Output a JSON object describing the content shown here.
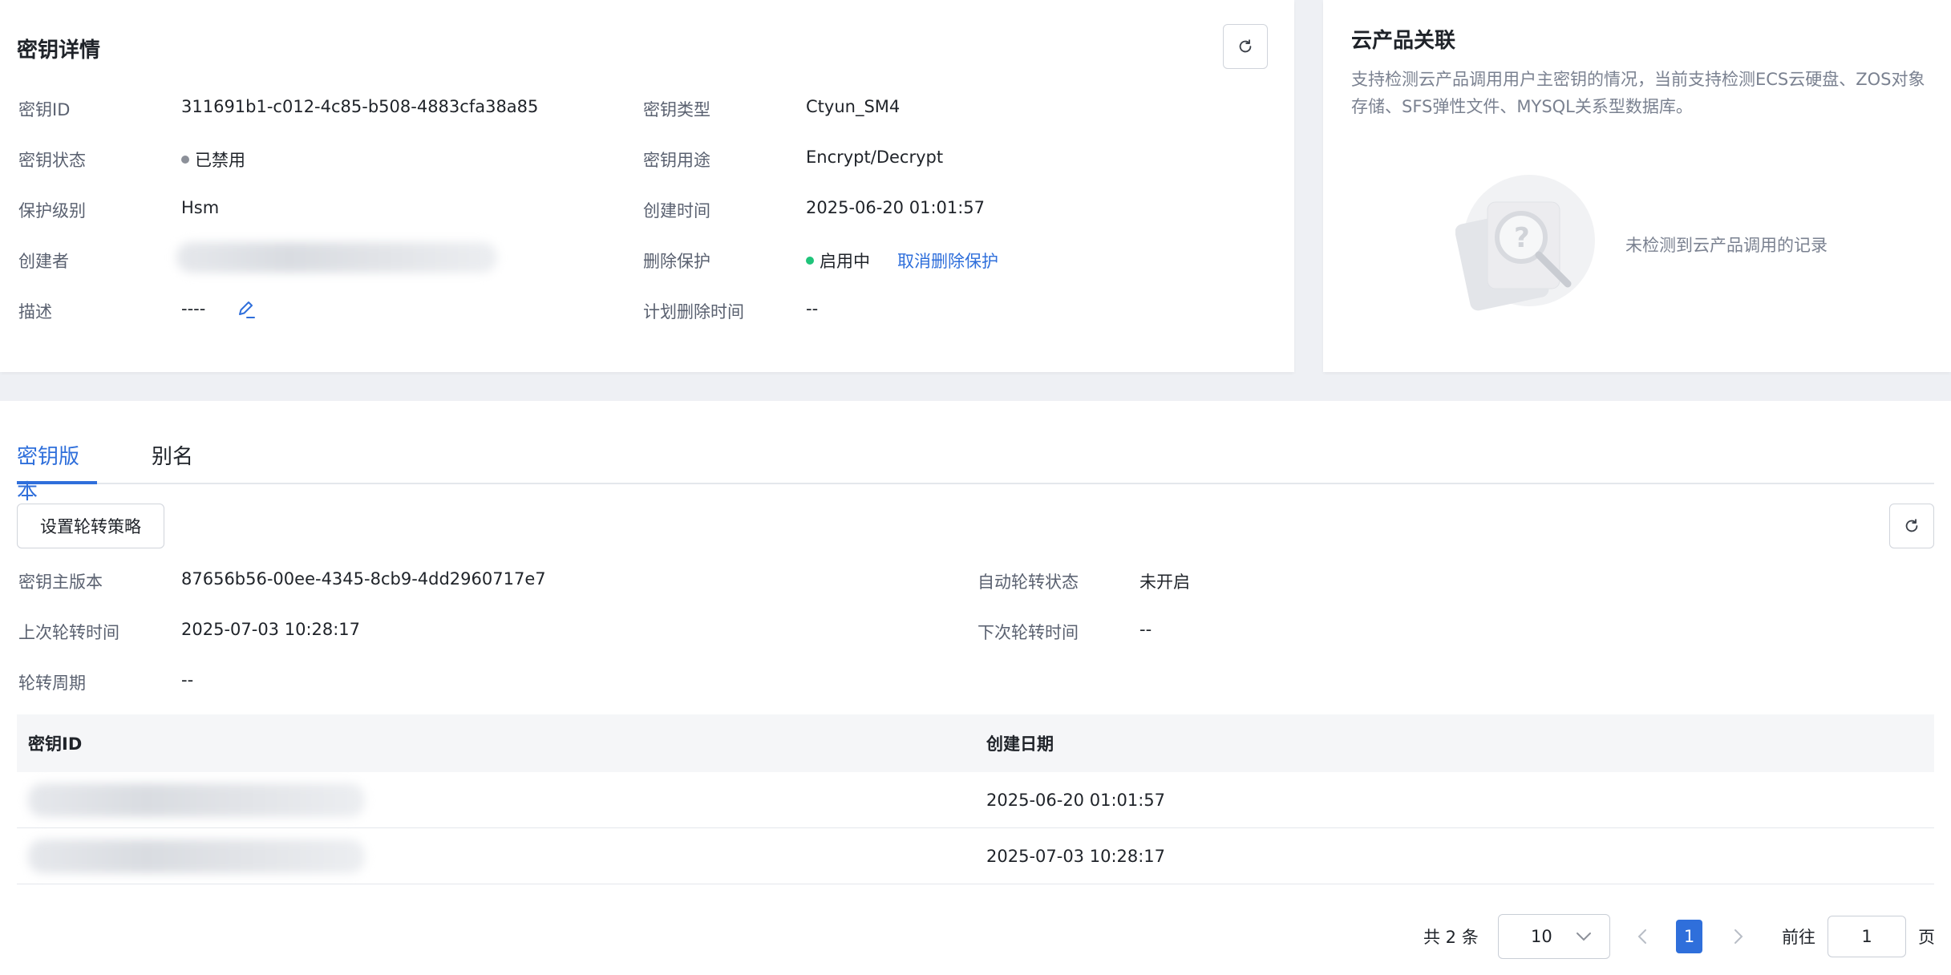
{
  "detail": {
    "title": "密钥详情",
    "fields_left": [
      {
        "label": "密钥ID",
        "value": "311691b1-c012-4c85-b508-4883cfa38a85"
      },
      {
        "label": "密钥状态",
        "value": "已禁用"
      },
      {
        "label": "保护级别",
        "value": "Hsm"
      },
      {
        "label": "创建者",
        "value": ""
      },
      {
        "label": "描述",
        "value": "----"
      }
    ],
    "fields_right": [
      {
        "label": "密钥类型",
        "value": "Ctyun_SM4"
      },
      {
        "label": "密钥用途",
        "value": "Encrypt/Decrypt"
      },
      {
        "label": "创建时间",
        "value": "2025-06-20 01:01:57"
      },
      {
        "label": "删除保护",
        "value": "启用中",
        "link": "取消删除保护"
      },
      {
        "label": "计划删除时间",
        "value": "--"
      }
    ]
  },
  "cloud": {
    "title": "云产品关联",
    "description": "支持检测云产品调用用户主密钥的情况，当前支持检测ECS云硬盘、ZOS对象存储、SFS弹性文件、MYSQL关系型数据库。",
    "empty_text": "未检测到云产品调用的记录"
  },
  "tabs": [
    {
      "label": "密钥版本",
      "active": true
    },
    {
      "label": "别名",
      "active": false
    }
  ],
  "rotation": {
    "button_label": "设置轮转策略",
    "fields_left": [
      {
        "label": "密钥主版本",
        "value": "87656b56-00ee-4345-8cb9-4dd2960717e7"
      },
      {
        "label": "上次轮转时间",
        "value": "2025-07-03 10:28:17"
      },
      {
        "label": "轮转周期",
        "value": "--"
      }
    ],
    "fields_right": [
      {
        "label": "自动轮转状态",
        "value": "未开启"
      },
      {
        "label": "下次轮转时间",
        "value": "--"
      }
    ]
  },
  "table": {
    "columns": [
      "密钥ID",
      "创建日期"
    ],
    "rows": [
      {
        "key_id": "",
        "created": "2025-06-20 01:01:57"
      },
      {
        "key_id": "",
        "created": "2025-07-03 10:28:17"
      }
    ]
  },
  "pagination": {
    "total": "共 2 条",
    "page_size": "10",
    "current_page": "1",
    "goto_label": "前往",
    "goto_value": "1",
    "page_unit": "页"
  },
  "colors": {
    "accent": "#2f6fdb",
    "disabled_dot": "#8c9099",
    "enabled_dot": "#1fc47a"
  }
}
